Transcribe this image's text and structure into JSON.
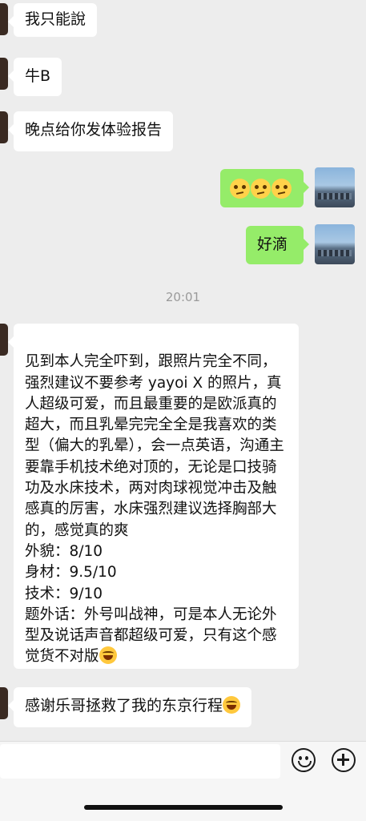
{
  "messages": {
    "m1": "我只能說",
    "m2": "牛B",
    "m3": "晚点给你发体验报告",
    "m4_icons": [
      "thinking-face-icon",
      "thinking-face-icon",
      "thinking-face-icon"
    ],
    "m5": "好滴",
    "time": "20:01",
    "m6": "见到本人完全吓到，跟照片完全不同，强烈建议不要参考 yayoi X 的照片，真人超级可爱，而且最重要的是欧派真的超大，而且乳晕完完全全是我喜欢的类型（偏大的乳晕），会一点英语，沟通主要靠手机技术绝对顶的，无论是口技骑功及水床技术，两对肉球视觉冲击及触感真的厉害，水床强烈建议选择胸部大的，感觉真的爽\n外貌：8/10\n身材：9.5/10\n技术：9/10\n题外话：外号叫战神，可是本人无论外型及说话声音都超级可爱，只有这个感觉货不对版",
    "m7": "感谢乐哥拯救了我的东京行程"
  },
  "colors": {
    "sent_bubble": "#95ec69",
    "received_bubble": "#ffffff",
    "background": "#ededed"
  }
}
